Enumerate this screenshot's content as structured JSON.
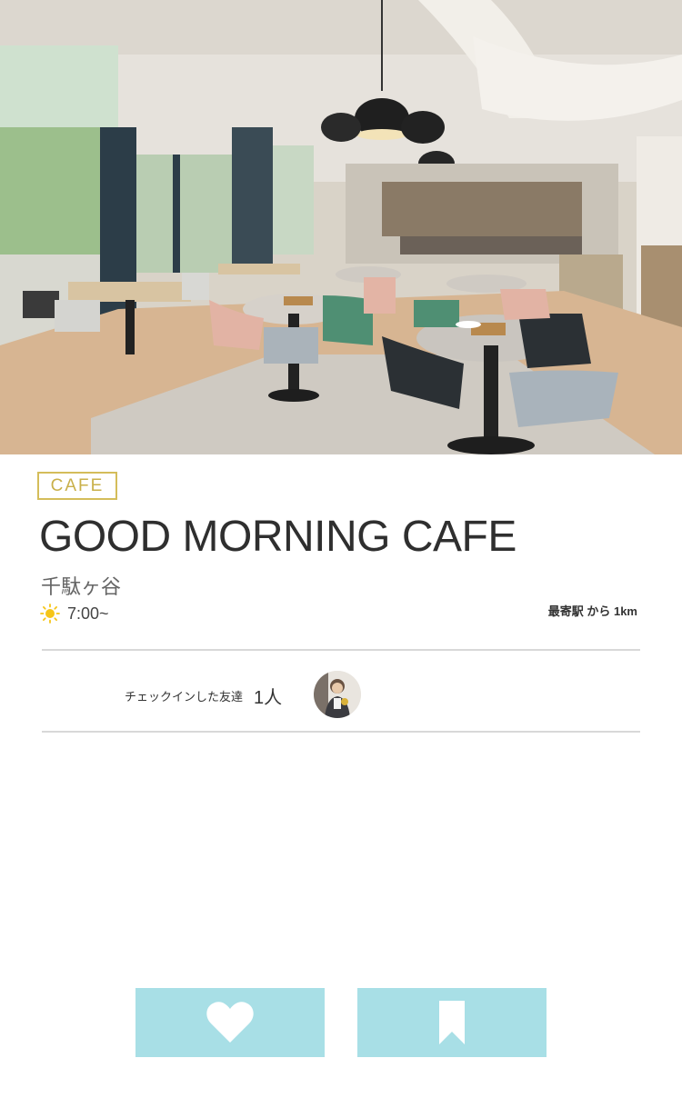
{
  "hero": {
    "image_alt": "cafe-interior-photo"
  },
  "shop": {
    "category": "CAFE",
    "name": "GOOD MORNING CAFE",
    "area": "千駄ヶ谷",
    "hours": "7:00~",
    "distance": "最寄駅 から 1km"
  },
  "friends": {
    "label": "チェックインした友達",
    "count": "1人"
  },
  "actions": {
    "like_icon": "heart-icon",
    "bookmark_icon": "bookmark-icon"
  },
  "colors": {
    "badge_gold": "#d4bd5a",
    "action_button": "#a8dfe6",
    "divider": "#d8d8d8",
    "sun": "#f5c518"
  }
}
